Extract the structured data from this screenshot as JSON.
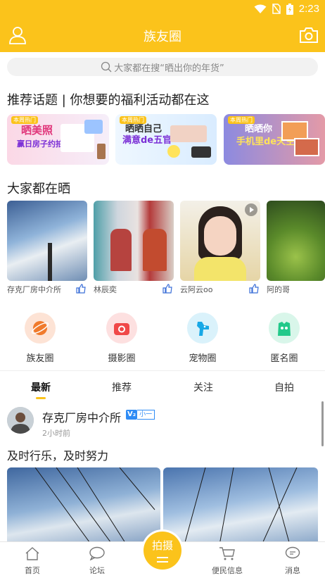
{
  "status": {
    "time": "2:23"
  },
  "appbar": {
    "title": "族友圈"
  },
  "search": {
    "placeholder": "大家都在搜“晒出你的年货”"
  },
  "topics": {
    "section_title": "推荐话题 | 你想要的福利活动都在这",
    "cards": [
      {
        "tag": "本周热门",
        "line1": "晒美照",
        "line2": "赢日房子约拍"
      },
      {
        "tag": "本周热门",
        "line1": "晒晒自己",
        "line2": "满意de五官"
      },
      {
        "tag": "本周热门",
        "line1": "晒晒你",
        "line2": "手机里de天空"
      }
    ]
  },
  "shares": {
    "section_title": "大家都在晒",
    "items": [
      {
        "user": "存克厂房中介所"
      },
      {
        "user": "林辰奕"
      },
      {
        "user": "云阿云oo"
      },
      {
        "user": "阿的哥"
      }
    ]
  },
  "circles": [
    {
      "label": "族友圈",
      "icon": "planet-icon",
      "color": "#fde3d5"
    },
    {
      "label": "摄影圈",
      "icon": "camera-icon",
      "color": "#fde0e0"
    },
    {
      "label": "宠物圈",
      "icon": "dog-icon",
      "color": "#daf2fb"
    },
    {
      "label": "匿名圈",
      "icon": "mask-icon",
      "color": "#d9f6ea"
    }
  ],
  "tabs": [
    "最新",
    "推荐",
    "关注",
    "自拍"
  ],
  "post": {
    "author": "存克厂房中介所",
    "badge_v": "V₂",
    "badge_text": "小一",
    "time": "2小时前",
    "text": "及时行乐，及时努力"
  },
  "bottom_nav": {
    "items": [
      "首页",
      "论坛",
      "便民信息",
      "消息"
    ],
    "fab": "拍摄"
  },
  "colors": {
    "brand": "#fbc31b",
    "verify": "#2f8cf5"
  }
}
